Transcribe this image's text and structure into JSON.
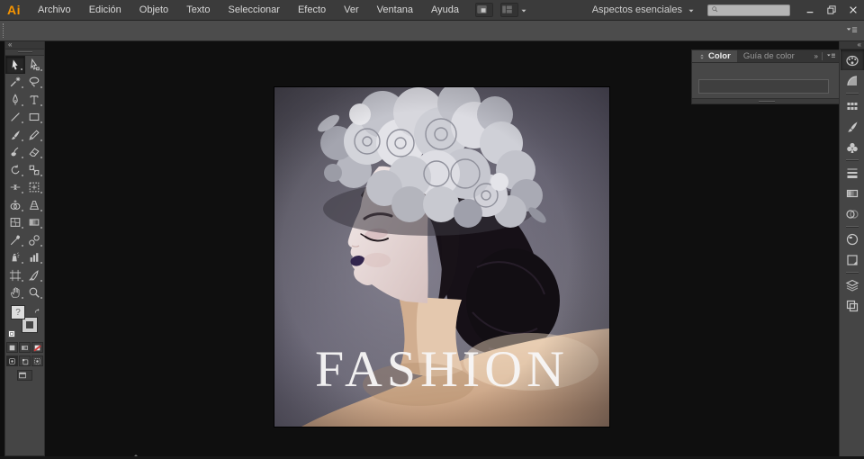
{
  "chrome": {
    "logo": "Ai",
    "menu_items": [
      "Archivo",
      "Edición",
      "Objeto",
      "Texto",
      "Seleccionar",
      "Efecto",
      "Ver",
      "Ventana",
      "Ayuda"
    ],
    "arrange_documents_icon": "arrange-documents-icon",
    "workspace_layout_icon": "workspace-layout-icon",
    "workspace_dropdown_icon": "dropdown-arrow-icon",
    "workspace_switcher_label": "Aspectos esenciales",
    "search": {
      "value": "",
      "icon": "search-icon"
    },
    "window_controls": [
      {
        "name": "minimize-button",
        "icon": "minimize-icon"
      },
      {
        "name": "restore-button",
        "icon": "restore-icon"
      },
      {
        "name": "close-button",
        "icon": "close-icon"
      }
    ]
  },
  "control_bar": {
    "menu_icon": "panel-menu-icon"
  },
  "toolbar": {
    "collapse_label": "«",
    "tools": [
      {
        "id": "selection",
        "icon": "selection-tool-icon",
        "active": true
      },
      {
        "id": "direct-selection",
        "icon": "direct-selection-tool-icon"
      },
      {
        "id": "magic-wand",
        "icon": "magic-wand-tool-icon"
      },
      {
        "id": "lasso",
        "icon": "lasso-tool-icon"
      },
      {
        "id": "pen",
        "icon": "pen-tool-icon"
      },
      {
        "id": "type",
        "icon": "type-tool-icon"
      },
      {
        "id": "line-segment",
        "icon": "line-segment-tool-icon"
      },
      {
        "id": "rectangle",
        "icon": "rectangle-tool-icon"
      },
      {
        "id": "paintbrush",
        "icon": "paintbrush-tool-icon"
      },
      {
        "id": "pencil",
        "icon": "pencil-tool-icon"
      },
      {
        "id": "blob-brush",
        "icon": "blob-brush-tool-icon"
      },
      {
        "id": "eraser",
        "icon": "eraser-tool-icon"
      },
      {
        "id": "rotate",
        "icon": "rotate-tool-icon"
      },
      {
        "id": "scale",
        "icon": "scale-tool-icon"
      },
      {
        "id": "width",
        "icon": "width-tool-icon"
      },
      {
        "id": "free-transform",
        "icon": "free-transform-tool-icon"
      },
      {
        "id": "shape-builder",
        "icon": "shape-builder-tool-icon"
      },
      {
        "id": "perspective-grid",
        "icon": "perspective-grid-tool-icon"
      },
      {
        "id": "mesh",
        "icon": "mesh-tool-icon"
      },
      {
        "id": "gradient",
        "icon": "gradient-icon"
      },
      {
        "id": "eyedropper",
        "icon": "eyedropper-tool-icon"
      },
      {
        "id": "blend",
        "icon": "blend-tool-icon"
      },
      {
        "id": "symbol-sprayer",
        "icon": "symbol-sprayer-tool-icon"
      },
      {
        "id": "column-graph",
        "icon": "column-graph-tool-icon"
      },
      {
        "id": "artboard",
        "icon": "artboard-tool-icon"
      },
      {
        "id": "slice",
        "icon": "slice-tool-icon"
      },
      {
        "id": "hand",
        "icon": "hand-tool-icon"
      },
      {
        "id": "zoom",
        "icon": "zoom-tool-icon"
      }
    ],
    "fill_hint": "?",
    "swap_icon": "swap-arrows-icon",
    "paint_buttons": [
      {
        "id": "color",
        "icon": "color-fill-icon"
      },
      {
        "id": "gradient",
        "icon": "gradient-icon"
      },
      {
        "id": "none",
        "icon": "none-icon"
      }
    ],
    "mode_buttons": [
      {
        "id": "draw-normal",
        "icon": "draw-normal-icon",
        "pressed": true
      },
      {
        "id": "draw-behind",
        "icon": "draw-behind-icon"
      },
      {
        "id": "draw-inside",
        "icon": "draw-inside-icon"
      }
    ],
    "screen_mode_icon": "screen-mode-icon"
  },
  "color_panel": {
    "tabs": [
      {
        "label": "Color",
        "active": true,
        "icon": "panel-collapse-icon"
      },
      {
        "label": "Guía de color",
        "active": false
      }
    ],
    "expand_label": "»",
    "menu_icon": "panel-menu-icon"
  },
  "dock": {
    "collapse_label": "«",
    "panels": [
      {
        "id": "color",
        "icon": "color-panel-icon",
        "group": 1,
        "active": true
      },
      {
        "id": "color-guide",
        "icon": "color-guide-icon",
        "group": 1
      },
      {
        "id": "swatches",
        "icon": "swatches-icon",
        "group": 2
      },
      {
        "id": "brushes",
        "icon": "brushes-icon",
        "group": 2
      },
      {
        "id": "symbols",
        "icon": "symbols-icon",
        "group": 2
      },
      {
        "id": "stroke",
        "icon": "stroke-icon",
        "group": 3
      },
      {
        "id": "gradient",
        "icon": "gradient-icon",
        "group": 3
      },
      {
        "id": "transparency",
        "icon": "transparency-icon",
        "group": 3
      },
      {
        "id": "appearance",
        "icon": "appearance-icon",
        "group": 4
      },
      {
        "id": "graphic-styles",
        "icon": "graphic-styles-icon",
        "group": 4
      },
      {
        "id": "layers",
        "icon": "layers-icon",
        "group": 5
      },
      {
        "id": "artboards",
        "icon": "artboards-icon",
        "group": 5
      }
    ]
  },
  "canvas": {
    "artwork": {
      "caption": "FASHION",
      "background_color": "#67646f",
      "subject": "woman-portrait-floral-headpiece"
    }
  },
  "colors": {
    "accent_orange": "#f79500",
    "ui_menubar": "#3b3b3b",
    "ui_panel": "#454545",
    "ui_canvas": "#0f0f0f",
    "none_slash_red": "#d03c3c",
    "lips_purple": "#32254d"
  }
}
